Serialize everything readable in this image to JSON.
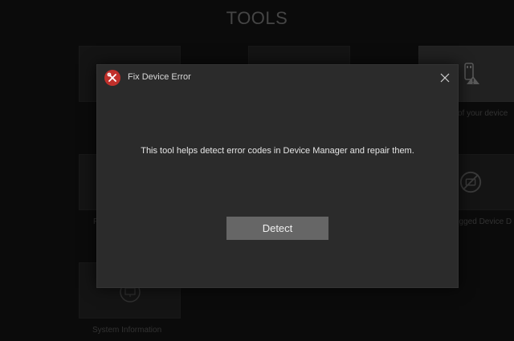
{
  "page": {
    "title": "TOOLS"
  },
  "tiles": [
    {
      "icon": "wrench-icon",
      "label": ""
    },
    {
      "icon": "wrench-icon",
      "label": ""
    },
    {
      "icon": "usb-warning-icon",
      "label": "of your device"
    },
    {
      "icon": "tool-icon",
      "label": "F"
    },
    {
      "icon": "tool-icon",
      "label": ""
    },
    {
      "icon": "unplugged-device-icon",
      "label": "ugged Device D"
    },
    {
      "icon": "monitor-icon",
      "label": "System Information"
    }
  ],
  "dialog": {
    "icon": "wrench-screwdriver-icon",
    "title": "Fix Device Error",
    "close_icon": "close-icon",
    "message": "This tool helps detect error codes in Device Manager and repair them.",
    "detect_label": "Detect"
  },
  "colors": {
    "background": "#111111",
    "dialog_bg": "#2b2b2b",
    "button_bg": "#666666",
    "accent_red": "#c0302b"
  }
}
